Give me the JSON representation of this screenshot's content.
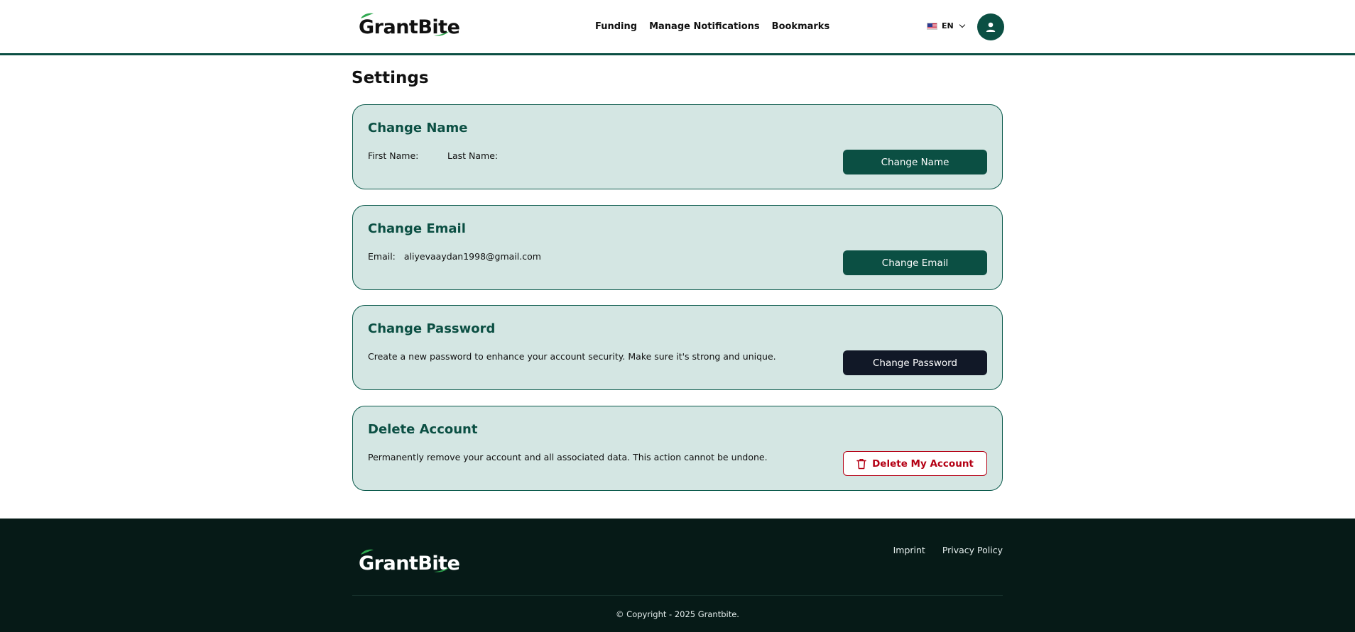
{
  "header": {
    "logo_text": "GrantBite",
    "nav": [
      "Funding",
      "Manage Notifications",
      "Bookmarks"
    ],
    "language": "EN"
  },
  "page_title": "Settings",
  "cards": {
    "name": {
      "title": "Change Name",
      "first_name_label": "First Name:",
      "last_name_label": "Last Name:",
      "button": "Change Name"
    },
    "email": {
      "title": "Change Email",
      "email_label": "Email:",
      "email_value": "aliyevaaydan1998@gmail.com",
      "button": "Change Email"
    },
    "password": {
      "title": "Change Password",
      "description": "Create a new password to enhance your account security. Make sure it's strong and unique.",
      "button": "Change Password"
    },
    "delete": {
      "title": "Delete Account",
      "description": "Permanently remove your account and all associated data. This action cannot be undone.",
      "button": "Delete My Account"
    }
  },
  "footer": {
    "logo_text": "GrantBite",
    "links": [
      "Imprint",
      "Privacy Policy"
    ],
    "copyright": "© Copyright - 2025 Grantbite."
  },
  "colors": {
    "brand": "#0b4f43",
    "card_bg": "#d4e6e3",
    "danger": "#b40014",
    "footer_bg": "#061a17"
  }
}
